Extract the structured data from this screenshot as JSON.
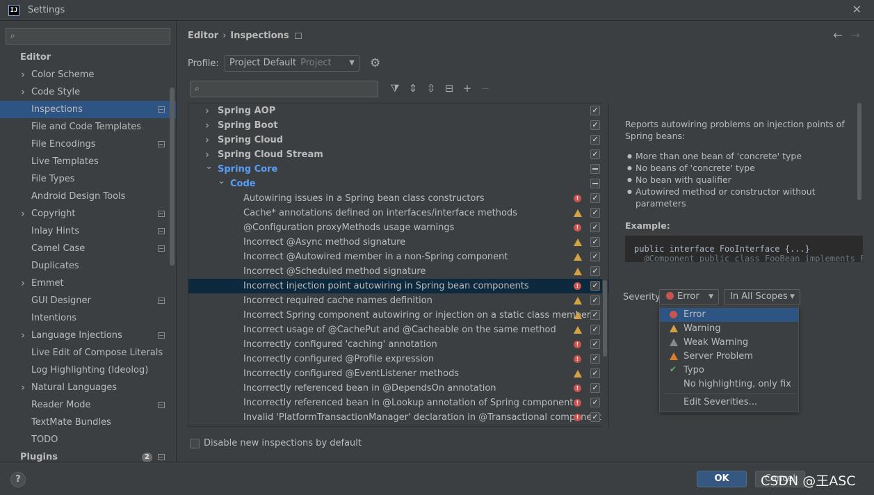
{
  "window": {
    "title": "Settings",
    "app_icon_text": "IJ"
  },
  "sidebar": {
    "search_placeholder": "",
    "items": [
      {
        "label": "Editor",
        "type": "header"
      },
      {
        "label": "Color Scheme",
        "expandable": true
      },
      {
        "label": "Code Style",
        "expandable": true
      },
      {
        "label": "Inspections",
        "selected": true,
        "project_icon": true
      },
      {
        "label": "File and Code Templates"
      },
      {
        "label": "File Encodings",
        "project_icon": true
      },
      {
        "label": "Live Templates"
      },
      {
        "label": "File Types"
      },
      {
        "label": "Android Design Tools"
      },
      {
        "label": "Copyright",
        "expandable": true,
        "project_icon": true
      },
      {
        "label": "Inlay Hints",
        "project_icon": true
      },
      {
        "label": "Camel Case",
        "project_icon": true
      },
      {
        "label": "Duplicates"
      },
      {
        "label": "Emmet",
        "expandable": true
      },
      {
        "label": "GUI Designer",
        "project_icon": true
      },
      {
        "label": "Intentions"
      },
      {
        "label": "Language Injections",
        "expandable": true,
        "project_icon": true
      },
      {
        "label": "Live Edit of Compose Literals"
      },
      {
        "label": "Log Highlighting (Ideolog)"
      },
      {
        "label": "Natural Languages",
        "expandable": true
      },
      {
        "label": "Reader Mode",
        "project_icon": true
      },
      {
        "label": "TextMate Bundles"
      },
      {
        "label": "TODO"
      },
      {
        "label": "Plugins",
        "type": "header",
        "badge": "2",
        "project_icon": true
      }
    ]
  },
  "breadcrumb": {
    "parent": "Editor",
    "current": "Inspections"
  },
  "profile": {
    "label": "Profile:",
    "value": "Project Default",
    "scope": "Project"
  },
  "search": {
    "placeholder": ""
  },
  "tree": [
    {
      "label": "Spring AOP",
      "level": 0,
      "style": "bold",
      "expanded": false,
      "checked": "on"
    },
    {
      "label": "Spring Boot",
      "level": 0,
      "style": "bold",
      "expanded": false,
      "checked": "on"
    },
    {
      "label": "Spring Cloud",
      "level": 0,
      "style": "bold",
      "expanded": false,
      "checked": "on"
    },
    {
      "label": "Spring Cloud Stream",
      "level": 0,
      "style": "bold",
      "expanded": false,
      "checked": "on"
    },
    {
      "label": "Spring Core",
      "level": 0,
      "style": "blue",
      "expanded": true,
      "checked": "mixed"
    },
    {
      "label": "Code",
      "level": 1,
      "style": "blue",
      "expanded": true,
      "checked": "mixed"
    },
    {
      "label": "Autowiring issues in a Spring bean class constructors",
      "level": 2,
      "severity": "error",
      "checked": "on"
    },
    {
      "label": "Cache* annotations defined on interfaces/interface methods",
      "level": 2,
      "severity": "warning",
      "checked": "on"
    },
    {
      "label": "@Configuration proxyMethods usage warnings",
      "level": 2,
      "severity": "error",
      "checked": "on"
    },
    {
      "label": "Incorrect @Async method signature",
      "level": 2,
      "severity": "warning",
      "checked": "on"
    },
    {
      "label": "Incorrect @Autowired member in a non-Spring component",
      "level": 2,
      "severity": "warning",
      "checked": "on"
    },
    {
      "label": "Incorrect @Scheduled method signature",
      "level": 2,
      "severity": "warning",
      "checked": "on"
    },
    {
      "label": "Incorrect injection point autowiring in Spring bean components",
      "level": 2,
      "severity": "error",
      "checked": "on",
      "selected": true
    },
    {
      "label": "Incorrect required cache names definition",
      "level": 2,
      "severity": "warning",
      "checked": "on"
    },
    {
      "label": "Incorrect Spring component autowiring or injection on a static class member",
      "level": 2,
      "severity": "warning",
      "checked": "on"
    },
    {
      "label": "Incorrect usage of @CachePut and @Cacheable on the same method",
      "level": 2,
      "severity": "warning",
      "checked": "on"
    },
    {
      "label": "Incorrectly configured 'caching' annotation",
      "level": 2,
      "severity": "error",
      "checked": "on"
    },
    {
      "label": "Incorrectly configured @Profile expression",
      "level": 2,
      "severity": "error",
      "checked": "on"
    },
    {
      "label": "Incorrectly configured  @EventListener methods",
      "level": 2,
      "severity": "warning",
      "checked": "on"
    },
    {
      "label": "Incorrectly referenced bean in @DependsOn annotation",
      "level": 2,
      "severity": "error",
      "checked": "on"
    },
    {
      "label": "Incorrectly referenced bean in @Lookup annotation of Spring component",
      "level": 2,
      "severity": "error",
      "checked": "on"
    },
    {
      "label": "Invalid 'PlatformTransactionManager' declaration in @Transactional component",
      "level": 2,
      "severity": "error",
      "checked": "on"
    }
  ],
  "disable_new": {
    "label": "Disable new inspections by default",
    "checked": false
  },
  "description": {
    "intro": "Reports autowiring problems on injection points of Spring beans:",
    "bullets": [
      "More than one bean of 'concrete' type",
      "No beans of 'concrete' type",
      "No bean with qualifier",
      "Autowired method or constructor without parameters"
    ],
    "example_label": "Example:",
    "code_line1": "public interface FooInterface {...}",
    "code_line2": "  @Component public class FooBean implements Fo"
  },
  "severity": {
    "label": "Severity:",
    "value": "Error",
    "scope_value": "In All Scopes",
    "options": [
      {
        "label": "Error",
        "icon": "error-icon",
        "selected": true
      },
      {
        "label": "Warning",
        "icon": "warning-icon"
      },
      {
        "label": "Weak Warning",
        "icon": "weak-warning-icon"
      },
      {
        "label": "Server Problem",
        "icon": "server-problem-icon"
      },
      {
        "label": "Typo",
        "icon": "typo-icon"
      },
      {
        "label": "No highlighting, only fix",
        "icon": ""
      },
      {
        "label": "Edit Severities...",
        "icon": ""
      }
    ]
  },
  "footer": {
    "help": "?",
    "ok": "OK",
    "cancel": "Cancel"
  },
  "watermark": "CSDN @王ASC",
  "colors": {
    "accent": "#365880",
    "selection": "#2d5483",
    "error": "#c75450",
    "warning": "#d3a243",
    "link": "#589df6"
  }
}
